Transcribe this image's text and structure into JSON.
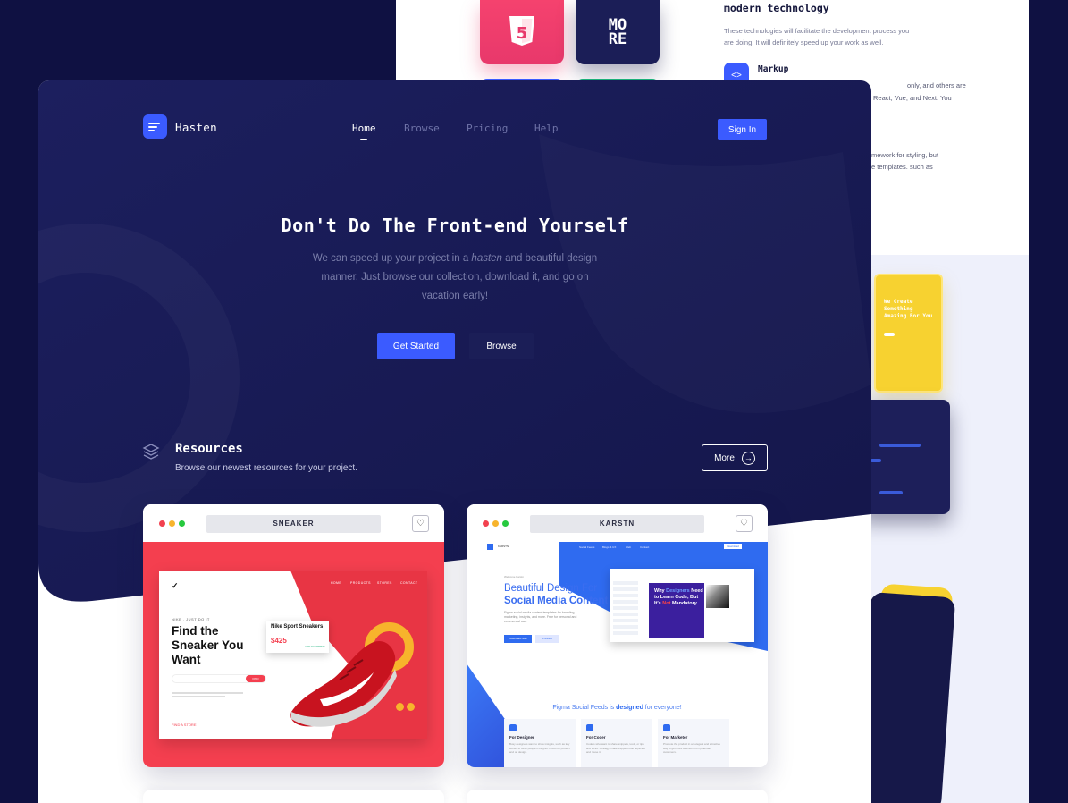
{
  "colors": {
    "accent": "#3b5bff",
    "navy": "#1b1e57",
    "sneaker_red": "#f43f4f"
  },
  "background_panel": {
    "tile_html5_label": "5",
    "tile_more_label": "MO RE",
    "title": "modern technology",
    "description": "These technologies will facilitate the development process you are doing. It will definitely speed up your work as well.",
    "markup_label": "Markup",
    "text1": "only, and others are",
    "text2": "React, Vue, and Next. You",
    "text3": "mework for styling, but",
    "text4": "e templates. such as",
    "phone_text": "We Create Something Amazing For You"
  },
  "header": {
    "brand": "Hasten",
    "nav": [
      "Home",
      "Browse",
      "Pricing",
      "Help"
    ],
    "active_nav": "Home",
    "sign_in": "Sign In"
  },
  "hero": {
    "title": "Don't Do The Front-end Yourself",
    "subtitle_before": "We can speed up your project in a ",
    "subtitle_em": "hasten",
    "subtitle_after": " and beautiful design manner. Just browse our collection, download it, and go on vacation early!",
    "primary_cta": "Get Started",
    "secondary_cta": "Browse"
  },
  "resources": {
    "title": "Resources",
    "subtitle": "Browse our newest resources for your project.",
    "more_label": "More",
    "cards": [
      {
        "url_label": "SNEAKER",
        "kicker": "NIKE . JUST DO IT",
        "headline": "Find the Sneaker You Want",
        "menu": [
          "HOME",
          "PRODUCTS",
          "STORES",
          "CONTACT"
        ],
        "product_name": "Nike Sport Sneakers",
        "product_price": "$425",
        "product_action": "ADD SHOPPING",
        "search_button": "FIND",
        "location": "FIND A STORE"
      },
      {
        "url_label": "KARSTN",
        "brand": "KARSTN",
        "nav": [
          "Social Feeds",
          "Blogs & UX",
          "Web",
          "Contact"
        ],
        "download": "Download",
        "kicker": "Welcome Karstn",
        "headline_1": "Beautiful Design For",
        "headline_2": "Social Media Content",
        "body": "Figma social media content templates for branding, marketing, insights, and more. Free for personal and commercial use.",
        "btn_download": "Download Now",
        "btn_preview": "Preview",
        "art_text_1": "Why ",
        "art_text_blue": "Designers",
        "art_text_2": " Need to Learn Code, But It's ",
        "art_text_red": "Not",
        "art_text_3": " Mandatory",
        "mid_before": "Figma Social Feeds is ",
        "mid_bold": "designed",
        "mid_after": " for everyone!",
        "columns": [
          {
            "title": "For Designer",
            "desc": "Busy designers want to show insights, such as key stories to other people's insights. Focus on product and on design."
          },
          {
            "title": "For Coder",
            "desc": "Coders who want to share snippets, tools, or tips and tricks. Strategy: make snippets look duplicate and reuse it."
          },
          {
            "title": "For Marketer",
            "desc": "Promote the product in an elegant and attractive way to get more attention from potential customers."
          }
        ]
      }
    ]
  }
}
